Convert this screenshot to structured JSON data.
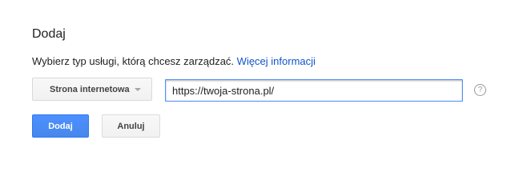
{
  "dialog": {
    "title": "Dodaj",
    "description": "Wybierz typ usługi, którą chcesz zarządzać.",
    "more_info_link": "Więcej informacji",
    "service_type": {
      "selected": "Strona internetowa"
    },
    "url_field": {
      "value": "https://twoja-strona.pl/"
    },
    "help_icon_glyph": "?",
    "buttons": {
      "add": "Dodaj",
      "cancel": "Anuluj"
    }
  },
  "colors": {
    "link": "#1155cc",
    "primary_button": "#4d90fe",
    "input_focus_border": "#4d90fe"
  },
  "icons": {
    "help": "question-circle-icon",
    "dropdown": "chevron-down-icon"
  }
}
